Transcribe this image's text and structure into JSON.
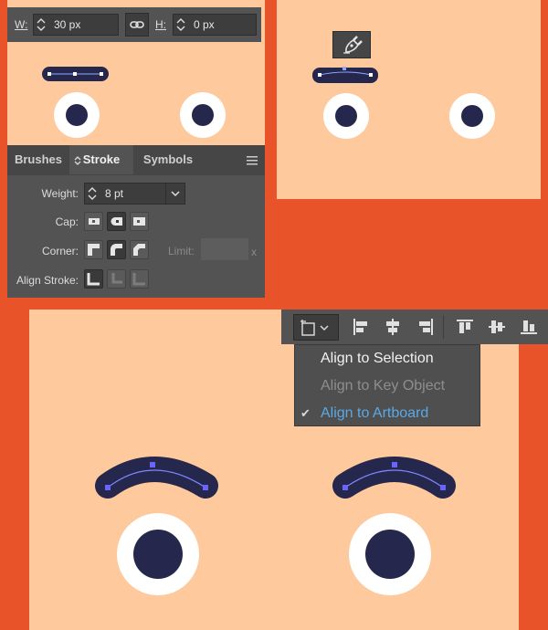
{
  "colors": {
    "background": "#e8532a",
    "face": "#fec99c",
    "eye_white": "#ffffff",
    "pupil": "#26274c",
    "brow": "#26274c",
    "accent": "#4aa3df"
  },
  "transform_bar": {
    "w_label": "W:",
    "w_value": "30 px",
    "h_label": "H:",
    "h_value": "0 px",
    "link_icon": "link-icon"
  },
  "stroke_panel": {
    "tabs": [
      "Brushes",
      "Stroke",
      "Symbols"
    ],
    "active_tab": "Stroke",
    "weight_label": "Weight:",
    "weight_value": "8 pt",
    "cap_label": "Cap:",
    "cap_selected": "round-cap",
    "corner_label": "Corner:",
    "corner_selected": "round-join",
    "limit_label": "Limit:",
    "limit_suffix": "x",
    "align_stroke_label": "Align Stroke:",
    "align_selected": "align-center"
  },
  "align_toolbar": {
    "icons": [
      "align-to-icon",
      "align-left-icon",
      "align-hcenter-icon",
      "align-right-icon",
      "align-top-icon",
      "align-vcenter-icon",
      "align-bottom-icon"
    ]
  },
  "align_menu": {
    "items": [
      {
        "label": "Align to Selection",
        "state": "normal"
      },
      {
        "label": "Align to Key Object",
        "state": "disabled"
      },
      {
        "label": "Align to Artboard",
        "state": "checked"
      }
    ],
    "check_mark": "✔"
  },
  "pen_tooltip_icon": "pen-tool-icon"
}
